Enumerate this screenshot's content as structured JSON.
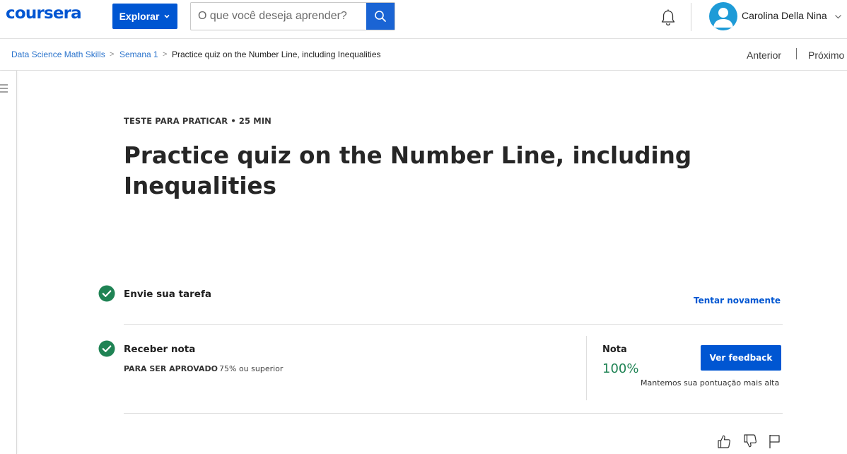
{
  "header": {
    "logo_text": "coursera",
    "explore_label": "Explorar",
    "search_placeholder": "O que você deseja aprender?",
    "user_name": "Carolina Della Nina",
    "icons": [
      "chevron-down-icon",
      "search-icon",
      "bell-icon",
      "user-icon"
    ]
  },
  "breadcrumb": {
    "items": [
      "Data Science Math Skills",
      "Semana 1",
      "Practice quiz on the Number Line, including Inequalities"
    ],
    "separator": ">",
    "prev_label": "Anterior",
    "next_label": "Próximo"
  },
  "quiz": {
    "eyebrow": "TESTE PARA PRATICAR • 25 MIN",
    "title": "Practice quiz on the Number Line, including Inequalities"
  },
  "steps": {
    "submit": {
      "title": "Envie sua tarefa",
      "action_label": "Tentar novamente",
      "completed": true
    },
    "grade": {
      "title": "Receber nota",
      "pass_label": "PARA SER APROVADO",
      "pass_value": "75% ou superior",
      "completed": true
    }
  },
  "grade_panel": {
    "label": "Nota",
    "value": "100%",
    "feedback_label": "Ver feedback",
    "note": "Mantemos sua pontuação mais alta"
  },
  "footer_icons": [
    "thumbs-up-icon",
    "thumbs-down-icon",
    "flag-icon"
  ],
  "colors": {
    "brand_blue": "#0056d2",
    "success_green": "#1f8354",
    "check_green": "#1f8354",
    "link_blue": "#2a73cc",
    "avatar_blue": "#1e9bd7"
  }
}
